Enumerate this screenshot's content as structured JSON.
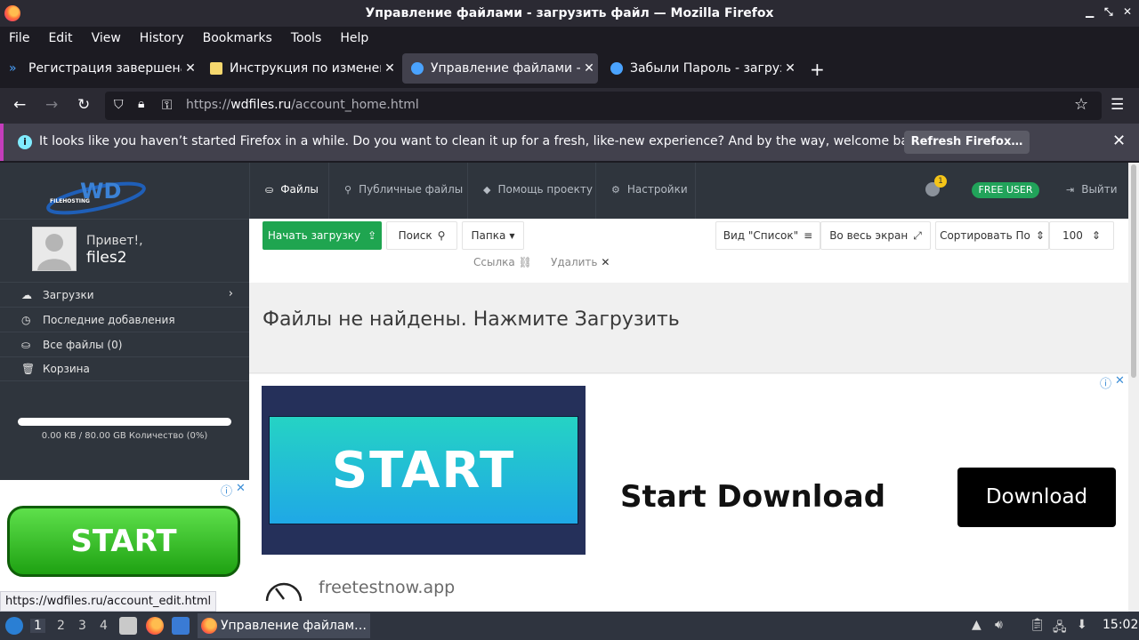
{
  "window": {
    "title": "Управление файлами - загрузить файл — Mozilla Firefox"
  },
  "menu": [
    "File",
    "Edit",
    "View",
    "History",
    "Bookmarks",
    "Tools",
    "Help"
  ],
  "tabs": [
    {
      "label": "Регистрация завершена",
      "active": false
    },
    {
      "label": "Инструкция по изменени",
      "active": false
    },
    {
      "label": "Управление файлами - з",
      "active": true
    },
    {
      "label": "Забыли Пароль - загрузи",
      "active": false
    }
  ],
  "url": {
    "prefix": "https://",
    "host": "wdfiles.ru",
    "path": "/account_home.html"
  },
  "notification": {
    "message": "It looks like you haven’t started Firefox in a while. Do you want to clean it up for a fresh, like-new experience? And by the way, welcome back!",
    "button": "Refresh Firefox…"
  },
  "site": {
    "logo_text": "WD",
    "logo_sub": "FILEHOSTING",
    "greeting": "Привет!,",
    "username": "files2",
    "sidebar": [
      {
        "label": "Загрузки",
        "icon": "cloud-upload-icon"
      },
      {
        "label": "Последние добавления",
        "icon": "clock-icon"
      },
      {
        "label": "Все файлы (0)",
        "icon": "drive-icon"
      },
      {
        "label": "Корзина",
        "icon": "trash-icon"
      }
    ],
    "storage": {
      "text": "0.00 KB / 80.00 GB Количество (0%)",
      "used_fraction": 0
    },
    "nav": [
      {
        "label": "Файлы",
        "active": true
      },
      {
        "label": "Публичные файлы",
        "active": false
      },
      {
        "label": "Помощь проекту",
        "active": false
      },
      {
        "label": "Настройки",
        "active": false
      }
    ],
    "notif_count": "1",
    "badge": "FREE USER",
    "logout": "Выйти",
    "toolbar": {
      "upload": "Начать загрузку",
      "search": "Поиск",
      "folder": "Папка",
      "view": "Вид \"Список\"",
      "fullscreen": "Во весь экран",
      "sort": "Сортировать По",
      "per_page": "100",
      "link": "Ссылка",
      "delete": "Удалить"
    },
    "empty_message": "Файлы не найдены. Нажмите Загрузить"
  },
  "ads": {
    "left_button": "START",
    "main_image_text": "START",
    "headline": "Start Download",
    "button": "Download",
    "domain": "freetestnow.app"
  },
  "status_link": "https://wdfiles.ru/account_edit.html",
  "taskbar": {
    "workspaces": [
      "1",
      "2",
      "3",
      "4"
    ],
    "active_window": "Управление файлам…",
    "clock": "15:02"
  },
  "colors": {
    "accent_green": "#1fa550",
    "sidebar_bg": "#2f353d",
    "notif_border": "#c43dbb"
  }
}
